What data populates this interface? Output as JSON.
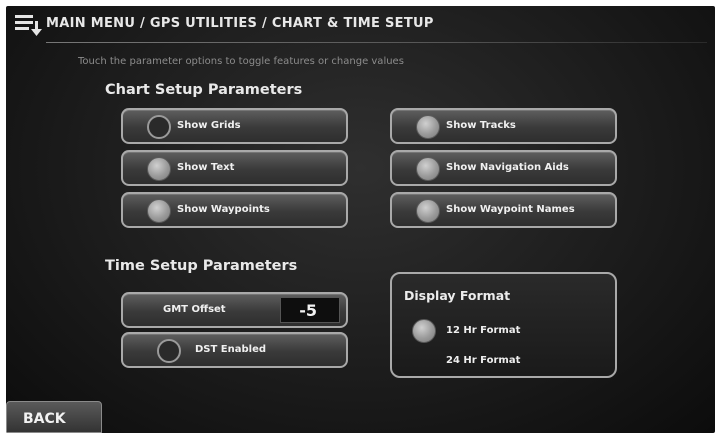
{
  "header": {
    "breadcrumb": "MAIN MENU / GPS UTILITIES / CHART & TIME SETUP",
    "icon": "menu-stack-icon"
  },
  "instructions": "Touch the parameter options to toggle features or change values",
  "chart_setup": {
    "heading": "Chart Setup Parameters",
    "options": [
      {
        "label": "Show Grids",
        "state": "off"
      },
      {
        "label": "Show Text",
        "state": "on"
      },
      {
        "label": "Show Waypoints",
        "state": "on"
      },
      {
        "label": "Show Tracks",
        "state": "on"
      },
      {
        "label": "Show Navigation Aids",
        "state": "on"
      },
      {
        "label": "Show Waypoint Names",
        "state": "on"
      }
    ]
  },
  "time_setup": {
    "heading": "Time Setup Parameters",
    "gmt_offset_label": "GMT Offset",
    "gmt_offset_value": "-5",
    "dst_label": "DST Enabled",
    "dst_state": "off"
  },
  "display_format": {
    "title": "Display Format",
    "options": [
      {
        "label": "12 Hr Format",
        "selected": true
      },
      {
        "label": "24 Hr Format",
        "selected": false
      }
    ]
  },
  "footer": {
    "back_label": "BACK"
  }
}
